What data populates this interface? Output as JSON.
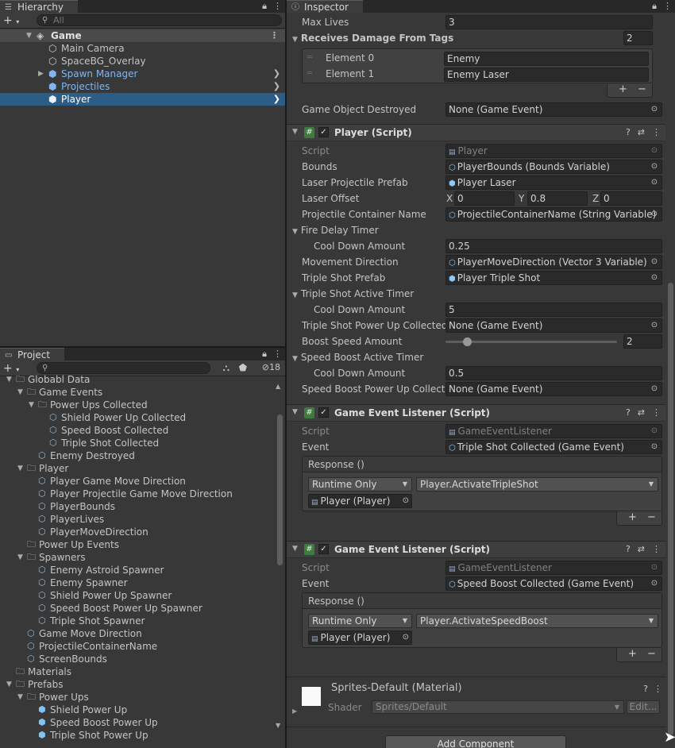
{
  "hierarchy": {
    "tab_label": "Hierarchy",
    "search_placeholder": "All",
    "scene": "Game",
    "items": [
      {
        "label": "Main Camera",
        "blue": false
      },
      {
        "label": "SpaceBG_Overlay",
        "blue": false
      },
      {
        "label": "Spawn Manager",
        "blue": true
      },
      {
        "label": "Projectiles",
        "blue": true
      },
      {
        "label": "Player",
        "blue": true,
        "selected": true
      }
    ]
  },
  "project": {
    "tab_label": "Project",
    "hidden_count": "18",
    "items": [
      {
        "label": "Globabl Data",
        "type": "folder"
      },
      {
        "label": "Game Events",
        "type": "folder"
      },
      {
        "label": "Power Ups Collected",
        "type": "folder"
      },
      {
        "label": "Shield Power Up Collected",
        "type": "asset"
      },
      {
        "label": "Speed Boost Collected",
        "type": "asset"
      },
      {
        "label": "Triple Shot Collected",
        "type": "asset"
      },
      {
        "label": "Enemy Destroyed",
        "type": "asset"
      },
      {
        "label": "Player",
        "type": "folder"
      },
      {
        "label": "Player Game Move Direction",
        "type": "asset"
      },
      {
        "label": "Player Projectile Game Move Direction",
        "type": "asset"
      },
      {
        "label": "PlayerBounds",
        "type": "asset"
      },
      {
        "label": "PlayerLives",
        "type": "asset"
      },
      {
        "label": "PlayerMoveDirection",
        "type": "asset"
      },
      {
        "label": "Power Up Events",
        "type": "folder"
      },
      {
        "label": "Spawners",
        "type": "folder"
      },
      {
        "label": "Enemy Astroid Spawner",
        "type": "asset"
      },
      {
        "label": "Enemy Spawner",
        "type": "asset"
      },
      {
        "label": "Shield Power Up Spawner",
        "type": "asset"
      },
      {
        "label": "Speed Boost Power Up Spawner",
        "type": "asset"
      },
      {
        "label": "Triple Shot Spawner",
        "type": "asset"
      },
      {
        "label": "Game Move Direction",
        "type": "asset"
      },
      {
        "label": "ProjectileContainerName",
        "type": "asset"
      },
      {
        "label": "ScreenBounds",
        "type": "asset"
      },
      {
        "label": "Materials",
        "type": "folder"
      },
      {
        "label": "Prefabs",
        "type": "folder"
      },
      {
        "label": "Power Ups",
        "type": "folder"
      },
      {
        "label": "Shield Power Up",
        "type": "prefab"
      },
      {
        "label": "Speed Boost Power Up",
        "type": "prefab"
      },
      {
        "label": "Triple Shot Power Up",
        "type": "prefab"
      }
    ]
  },
  "inspector": {
    "tab_label": "Inspector",
    "max_lives_label": "Max Lives",
    "max_lives_value": "3",
    "receives_damage_label": "Receives Damage From Tags",
    "receives_damage_count": "2",
    "elements": [
      {
        "label": "Element 0",
        "value": "Enemy"
      },
      {
        "label": "Element 1",
        "value": "Enemy Laser"
      }
    ],
    "game_object_destroyed_label": "Game Object Destroyed",
    "game_object_destroyed_value": "None (Game Event)",
    "player_script": {
      "title": "Player (Script)",
      "script_label": "Script",
      "script_value": "Player",
      "bounds_label": "Bounds",
      "bounds_value": "PlayerBounds (Bounds Variable)",
      "laser_prefab_label": "Laser Projectile Prefab",
      "laser_prefab_value": "Player Laser",
      "laser_offset_label": "Laser Offset",
      "laser_offset": {
        "x": "0",
        "y": "0.8",
        "z": "0"
      },
      "proj_container_label": "Projectile Container Name",
      "proj_container_value": "ProjectileContainerName (String Variable)",
      "fire_delay_label": "Fire Delay Timer",
      "cooldown_label": "Cool Down Amount",
      "fire_delay_cooldown": "0.25",
      "move_dir_label": "Movement Direction",
      "move_dir_value": "PlayerMoveDirection (Vector 3 Variable)",
      "triple_prefab_label": "Triple Shot Prefab",
      "triple_prefab_value": "Player Triple Shot",
      "triple_timer_label": "Triple Shot Active Timer",
      "triple_cooldown": "5",
      "triple_collected_label": "Triple Shot Power Up Collected",
      "triple_collected_value": "None (Game Event)",
      "boost_speed_label": "Boost Speed Amount",
      "boost_speed_value": "2",
      "speed_timer_label": "Speed Boost Active Timer",
      "speed_cooldown": "0.5",
      "speed_collected_label": "Speed Boost Power Up Collecte",
      "speed_collected_value": "None (Game Event)"
    },
    "listener1": {
      "title": "Game Event Listener (Script)",
      "script_label": "Script",
      "script_value": "GameEventListener",
      "event_label": "Event",
      "event_value": "Triple Shot Collected (Game Event)",
      "response_label": "Response ()",
      "runtime": "Runtime Only",
      "method": "Player.ActivateTripleShot",
      "target": "Player (Player)"
    },
    "listener2": {
      "title": "Game Event Listener (Script)",
      "script_label": "Script",
      "script_value": "GameEventListener",
      "event_label": "Event",
      "event_value": "Speed Boost Collected (Game Event)",
      "response_label": "Response ()",
      "runtime": "Runtime Only",
      "method": "Player.ActivateSpeedBoost",
      "target": "Player (Player)"
    },
    "material": {
      "title": "Sprites-Default (Material)",
      "shader_label": "Shader",
      "shader_value": "Sprites/Default",
      "edit_label": "Edit..."
    },
    "add_component_label": "Add Component"
  }
}
